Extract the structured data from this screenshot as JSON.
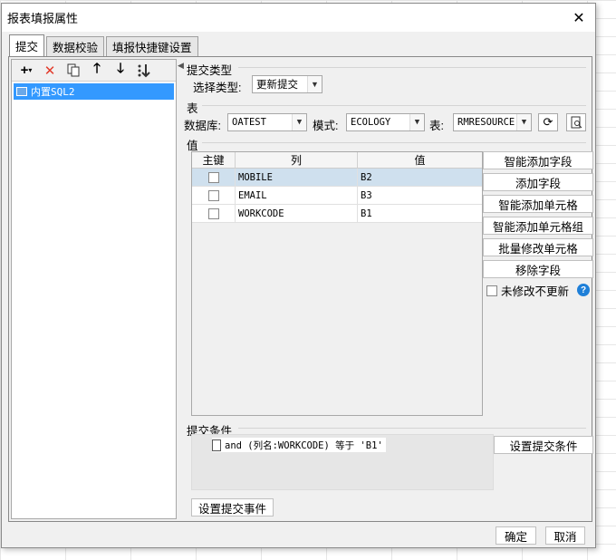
{
  "window": {
    "title": "报表填报属性"
  },
  "tabs": [
    {
      "label": "提交"
    },
    {
      "label": "数据校验"
    },
    {
      "label": "填报快捷键设置"
    }
  ],
  "tree": {
    "items": [
      {
        "label": "内置SQL2"
      }
    ]
  },
  "submit_type": {
    "section": "提交类型",
    "label": "选择类型:",
    "value": "更新提交"
  },
  "table_section": {
    "section": "表",
    "db_label": "数据库:",
    "db_value": "OATEST",
    "schema_label": "模式:",
    "schema_value": "ECOLOGY",
    "table_label": "表:",
    "table_value": "RMRESOURCE"
  },
  "values_section": {
    "section": "值",
    "columns": [
      "主键",
      "列",
      "值"
    ],
    "rows": [
      {
        "key": false,
        "column": "MOBILE",
        "value": "B2"
      },
      {
        "key": false,
        "column": "EMAIL",
        "value": "B3"
      },
      {
        "key": false,
        "column": "WORKCODE",
        "value": "B1"
      }
    ]
  },
  "side_buttons": {
    "smart_add_field": "智能添加字段",
    "add_field": "添加字段",
    "smart_add_cell": "智能添加单元格",
    "smart_add_cell_group": "智能添加单元格组",
    "batch_modify_cell": "批量修改单元格",
    "remove_field": "移除字段",
    "no_update_unmodified": "未修改不更新"
  },
  "condition": {
    "section": "提交条件",
    "item": "and (列名:WORKCODE) 等于 'B1'",
    "set_button": "设置提交条件"
  },
  "event_button": "设置提交事件",
  "footer": {
    "ok": "确定",
    "cancel": "取消"
  }
}
